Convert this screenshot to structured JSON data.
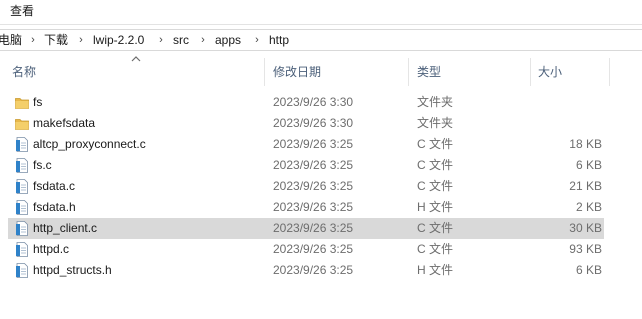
{
  "ribbon": {
    "view_label": "查看"
  },
  "breadcrumb": {
    "items": [
      "电脑",
      "下载",
      "lwip-2.2.0",
      "src",
      "apps",
      "http"
    ]
  },
  "columns": {
    "name": "名称",
    "date": "修改日期",
    "type": "类型",
    "size": "大小"
  },
  "files": [
    {
      "name": "fs",
      "date": "2023/9/26 3:30",
      "type": "文件夹",
      "size": "",
      "icon": "folder-icon"
    },
    {
      "name": "makefsdata",
      "date": "2023/9/26 3:30",
      "type": "文件夹",
      "size": "",
      "icon": "folder-icon"
    },
    {
      "name": "altcp_proxyconnect.c",
      "date": "2023/9/26 3:25",
      "type": "C 文件",
      "size": "18 KB",
      "icon": "c-file-icon"
    },
    {
      "name": "fs.c",
      "date": "2023/9/26 3:25",
      "type": "C 文件",
      "size": "6 KB",
      "icon": "c-file-icon"
    },
    {
      "name": "fsdata.c",
      "date": "2023/9/26 3:25",
      "type": "C 文件",
      "size": "21 KB",
      "icon": "c-file-icon"
    },
    {
      "name": "fsdata.h",
      "date": "2023/9/26 3:25",
      "type": "H 文件",
      "size": "2 KB",
      "icon": "h-file-icon"
    },
    {
      "name": "http_client.c",
      "date": "2023/9/26 3:25",
      "type": "C 文件",
      "size": "30 KB",
      "icon": "c-file-icon",
      "selected": true
    },
    {
      "name": "httpd.c",
      "date": "2023/9/26 3:25",
      "type": "C 文件",
      "size": "93 KB",
      "icon": "c-file-icon"
    },
    {
      "name": "httpd_structs.h",
      "date": "2023/9/26 3:25",
      "type": "H 文件",
      "size": "6 KB",
      "icon": "h-file-icon"
    }
  ],
  "colors": {
    "selected_row": "#d9d9d9",
    "header_text": "#4c607a",
    "folder": "#e8b84a"
  }
}
